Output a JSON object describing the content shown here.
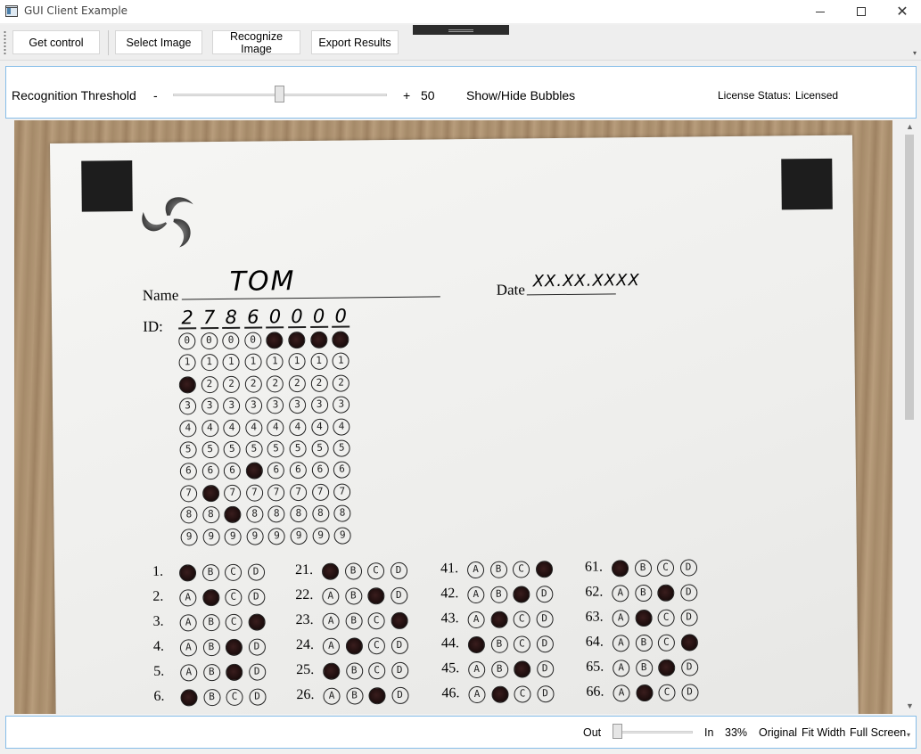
{
  "window": {
    "title": "GUI Client Example",
    "minimize_icon": "minimize-icon",
    "maximize_icon": "maximize-icon",
    "close_icon": "close-icon"
  },
  "toolbar": {
    "get_control": "Get control",
    "select_image": "Select Image",
    "recognize_image": "Recognize Image",
    "export_results": "Export Results"
  },
  "threshold": {
    "label": "Recognition Threshold",
    "minus": "-",
    "plus": "+",
    "value": "50",
    "level_percent": 50,
    "show_hide": "Show/Hide Bubbles",
    "license_label": "License Status:",
    "license_value": "Licensed"
  },
  "sheet": {
    "name_label": "Name",
    "name_value": "TOM",
    "date_label": "Date",
    "date_value": "XX.XX.XXXX",
    "id_label": "ID:",
    "id_digits": [
      "2",
      "7",
      "8",
      "6",
      "0",
      "0",
      "0",
      "0"
    ],
    "id_rows": [
      "0",
      "1",
      "2",
      "3",
      "4",
      "5",
      "6",
      "7",
      "8",
      "9"
    ],
    "options": [
      "A",
      "B",
      "C",
      "D"
    ],
    "questions": [
      {
        "num": "1.",
        "filled": 0
      },
      {
        "num": "2.",
        "filled": 1
      },
      {
        "num": "3.",
        "filled": 3
      },
      {
        "num": "4.",
        "filled": 2
      },
      {
        "num": "5.",
        "filled": 2
      },
      {
        "num": "6.",
        "filled": 0
      },
      {
        "num": "21.",
        "filled": 0
      },
      {
        "num": "22.",
        "filled": 2
      },
      {
        "num": "23.",
        "filled": 3
      },
      {
        "num": "24.",
        "filled": 1
      },
      {
        "num": "25.",
        "filled": 0
      },
      {
        "num": "26.",
        "filled": 2
      },
      {
        "num": "41.",
        "filled": 3
      },
      {
        "num": "42.",
        "filled": 2
      },
      {
        "num": "43.",
        "filled": 1
      },
      {
        "num": "44.",
        "filled": 0
      },
      {
        "num": "45.",
        "filled": 2
      },
      {
        "num": "46.",
        "filled": 1
      },
      {
        "num": "61.",
        "filled": 0
      },
      {
        "num": "62.",
        "filled": 2
      },
      {
        "num": "63.",
        "filled": 1
      },
      {
        "num": "64.",
        "filled": 3
      },
      {
        "num": "65.",
        "filled": 2
      },
      {
        "num": "66.",
        "filled": 1
      }
    ]
  },
  "zoom": {
    "out": "Out",
    "in": "In",
    "level": "33%",
    "original": "Original",
    "fit_width": "Fit Width",
    "full_screen": "Full Screen"
  }
}
